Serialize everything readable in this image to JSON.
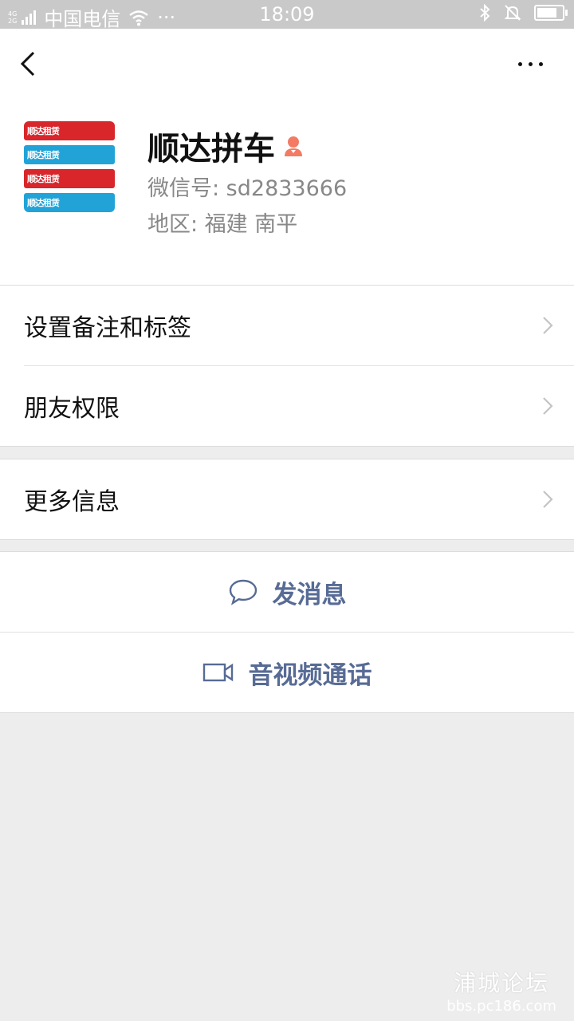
{
  "status_bar": {
    "network_top": "4G",
    "network_bottom": "2G",
    "carrier": "中国电信",
    "overflow": "···",
    "time": "18:09",
    "battery_level": 0.8,
    "icons": [
      "signal-icon",
      "wifi-icon",
      "bluetooth-icon",
      "mute-bell-icon",
      "battery-icon"
    ]
  },
  "nav": {
    "back_icon": "chevron-left-icon",
    "more_icon": "more-dots-icon"
  },
  "profile": {
    "avatar_rows": [
      {
        "text": "顺达租赁",
        "color": "#d8262b"
      },
      {
        "text": "顺达租赁",
        "color": "#21a3d8"
      },
      {
        "text": "顺达租赁",
        "color": "#d8262b"
      },
      {
        "text": "顺达租赁",
        "color": "#21a3d8"
      }
    ],
    "name": "顺达拼车",
    "gender_icon": "female-icon",
    "gender_color": "#f37b63",
    "wechat_id": "微信号:  sd2833666",
    "region": "地区:  福建  南平"
  },
  "menu_group_1": [
    {
      "label": "设置备注和标签"
    },
    {
      "label": "朋友权限"
    }
  ],
  "menu_group_2": [
    {
      "label": "更多信息"
    }
  ],
  "actions": {
    "send_message": "发消息",
    "video_call": "音视频通话",
    "accent_color": "#576b95"
  },
  "watermark": {
    "title": "浦城论坛",
    "url": "bbs.pc186.com"
  }
}
